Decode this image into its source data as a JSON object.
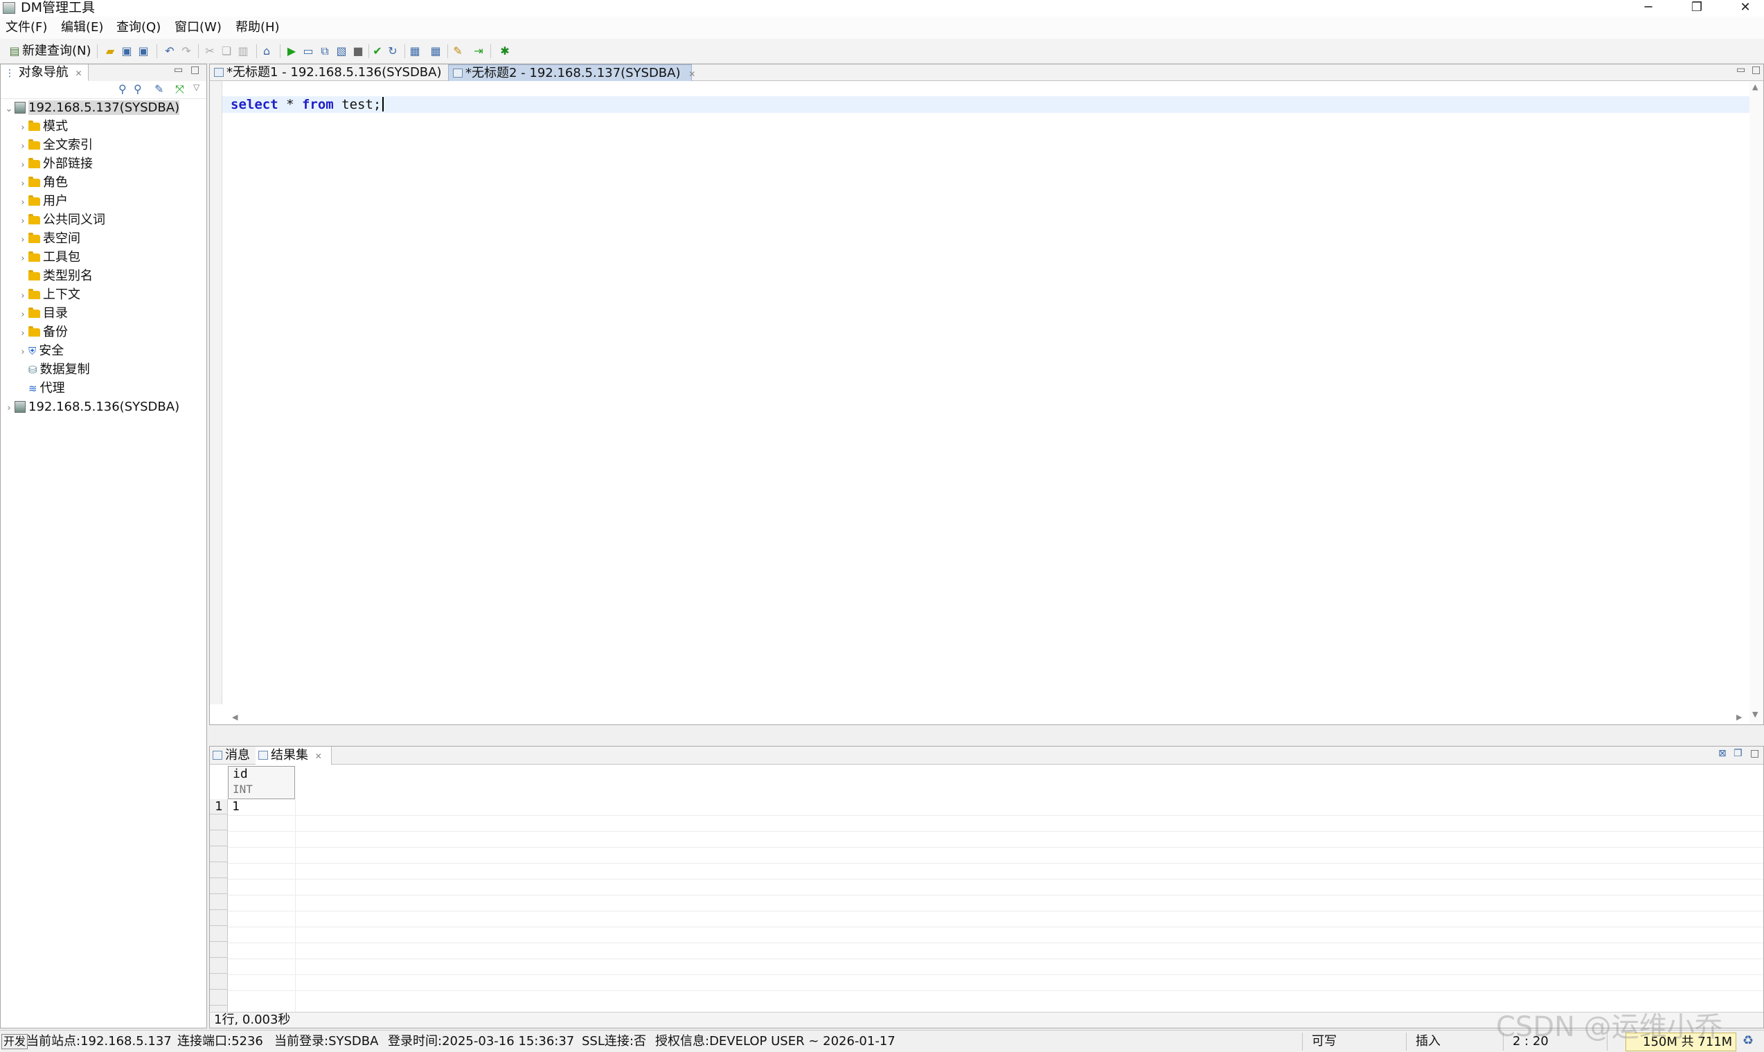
{
  "window": {
    "title": "DM管理工具",
    "minimize": "─",
    "restore": "❐",
    "close": "✕"
  },
  "menu": [
    "文件(F)",
    "编辑(E)",
    "查询(Q)",
    "窗口(W)",
    "帮助(H)"
  ],
  "toolbar": {
    "new_query": "新建查询(N)",
    "icons": [
      "open-icon",
      "save-icon",
      "save-all-icon",
      "undo-icon",
      "redo-icon",
      "cut-icon",
      "copy-icon",
      "paste-icon",
      "home-icon",
      "run-icon",
      "run-step-icon",
      "explain-icon",
      "run-script-icon",
      "stop-icon",
      "commit-icon",
      "rollback-icon",
      "grid-icon",
      "grid2-icon",
      "format-icon",
      "debug-step-icon",
      "bug-icon"
    ]
  },
  "navigator": {
    "title": "对象导航",
    "tree": [
      {
        "label": "192.168.5.137(SYSDBA)",
        "level": 0,
        "expanded": true,
        "icon": "server-icon",
        "selected": true
      },
      {
        "label": "模式",
        "level": 1,
        "icon": "folder-icon"
      },
      {
        "label": "全文索引",
        "level": 1,
        "icon": "folder-icon"
      },
      {
        "label": "外部链接",
        "level": 1,
        "icon": "folder-icon"
      },
      {
        "label": "角色",
        "level": 1,
        "icon": "folder-icon"
      },
      {
        "label": "用户",
        "level": 1,
        "icon": "folder-icon"
      },
      {
        "label": "公共同义词",
        "level": 1,
        "icon": "folder-icon"
      },
      {
        "label": "表空间",
        "level": 1,
        "icon": "folder-icon"
      },
      {
        "label": "工具包",
        "level": 1,
        "icon": "folder-icon"
      },
      {
        "label": "类型别名",
        "level": 1,
        "icon": "folder-icon"
      },
      {
        "label": "上下文",
        "level": 1,
        "icon": "folder-icon"
      },
      {
        "label": "目录",
        "level": 1,
        "icon": "folder-icon"
      },
      {
        "label": "备份",
        "level": 1,
        "icon": "folder-icon"
      },
      {
        "label": "安全",
        "level": 1,
        "icon": "shield-icon"
      },
      {
        "label": "数据复制",
        "level": 1,
        "icon": "replication-icon"
      },
      {
        "label": "代理",
        "level": 1,
        "icon": "agent-icon"
      },
      {
        "label": "192.168.5.136(SYSDBA)",
        "level": 0,
        "expanded": false,
        "icon": "server-icon"
      }
    ]
  },
  "editor": {
    "tabs": [
      {
        "label": "*无标题1 - 192.168.5.136(SYSDBA)",
        "active": false
      },
      {
        "label": "*无标题2 - 192.168.5.137(SYSDBA)",
        "active": true
      }
    ],
    "code": {
      "kw1": "select",
      "mid": " * ",
      "kw2": "from",
      "rest": " test;"
    }
  },
  "results": {
    "tabs": [
      {
        "label": "消息",
        "active": false
      },
      {
        "label": "结果集",
        "active": true
      }
    ],
    "column": {
      "name": "id",
      "type": "INT"
    },
    "rows": [
      {
        "num": "1",
        "value": "1"
      }
    ],
    "status": "1行, 0.003秒"
  },
  "statusbar": {
    "mode_badge": "开发",
    "site": "当前站点:192.168.5.137",
    "port": "连接端口:5236",
    "login": "当前登录:SYSDBA",
    "login_time": "登录时间:2025-03-16 15:36:37",
    "ssl": "SSL连接:否",
    "license": "授权信息:DEVELOP USER ~ 2026-01-17",
    "writable": "可写",
    "insert": "插入",
    "cursor": "2 : 20",
    "memory": "150M 共 711M"
  },
  "watermark": "CSDN @运维小乔"
}
